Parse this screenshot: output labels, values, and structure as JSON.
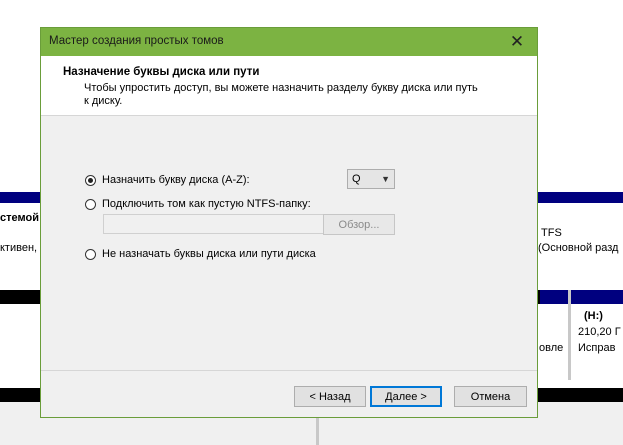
{
  "background": {
    "row1_text_a": "стемой",
    "row1_text_b": "ктивен,",
    "row1_text_c": "TFS",
    "row1_text_d": "(Основной разд",
    "drive_label": "(H:)",
    "drive_size": "210,20 Г",
    "drive_status_left": "овле",
    "drive_status_right": "Исправ"
  },
  "dialog": {
    "title": "Мастер создания простых томов",
    "header_title": "Назначение буквы диска или пути",
    "header_desc": "Чтобы упростить доступ, вы можете назначить разделу букву диска или путь к диску.",
    "options": {
      "assign_letter": "Назначить букву диска (A-Z):",
      "mount_folder": "Подключить том как пустую NTFS-папку:",
      "no_letter": "Не назначать буквы диска или пути диска"
    },
    "selected_option": "assign_letter",
    "drive_letter": "Q",
    "folder_path": "",
    "browse_label": "Обзор...",
    "buttons": {
      "back": "< Назад",
      "next": "Далее >",
      "cancel": "Отмена"
    }
  },
  "colors": {
    "titlebar": "#7cb342",
    "navy_bar": "#00007f",
    "focus_border": "#0078d7"
  }
}
